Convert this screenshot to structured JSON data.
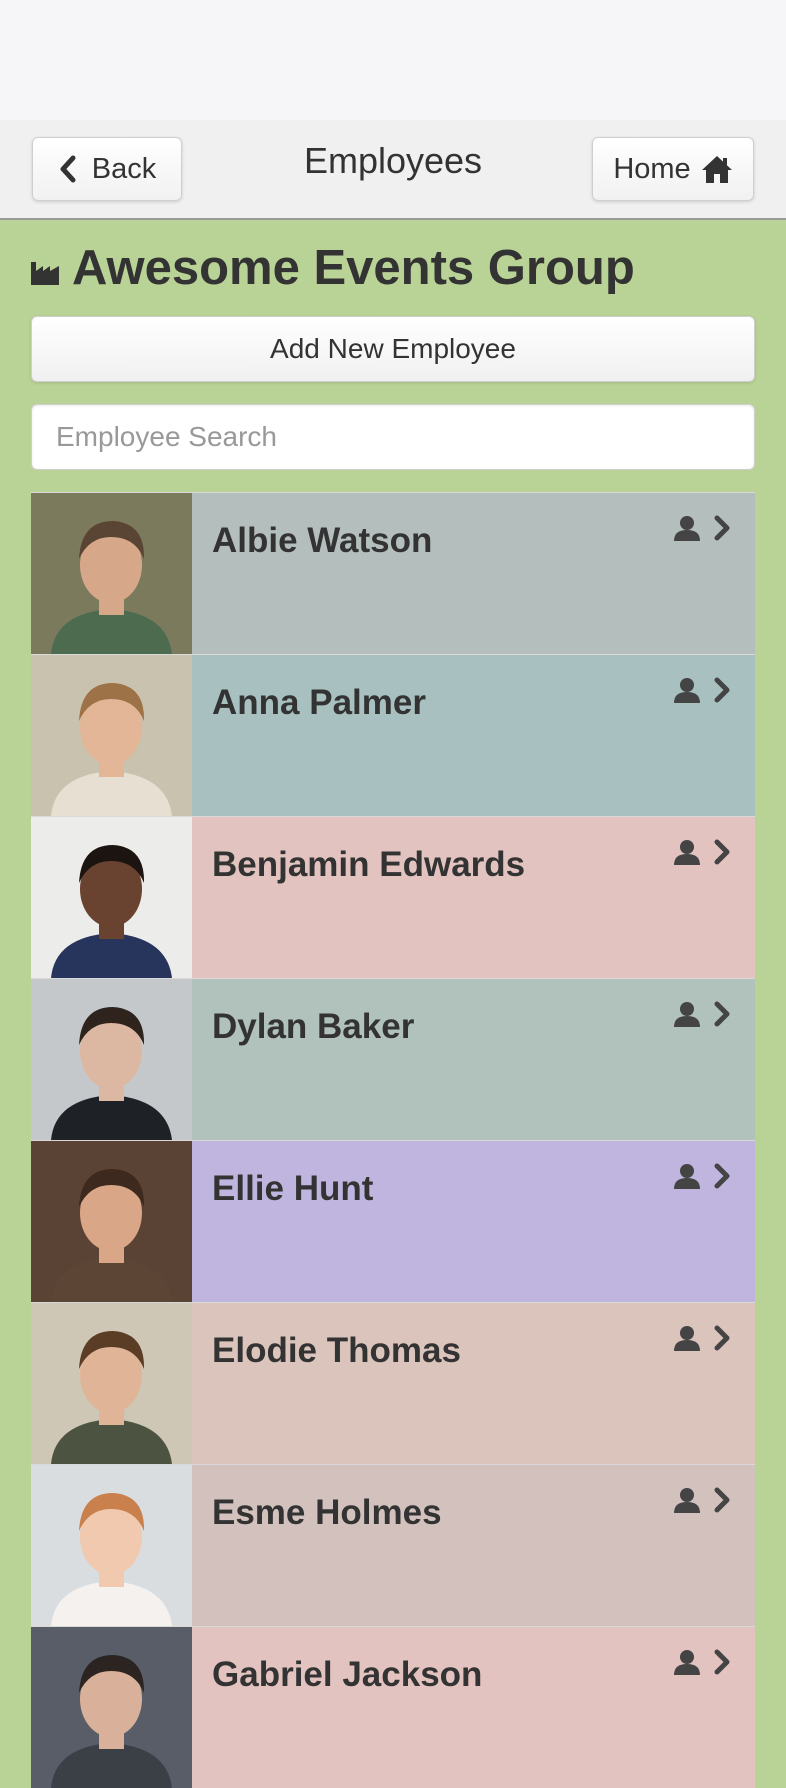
{
  "header": {
    "back_label": "Back",
    "title": "Employees",
    "home_label": "Home"
  },
  "company": {
    "name": "Awesome Events Group",
    "icon": "industry-icon"
  },
  "actions": {
    "add_label": "Add New Employee"
  },
  "search": {
    "placeholder": "Employee Search",
    "value": ""
  },
  "employees": [
    {
      "name": "Albie Watson",
      "color": "#b4bfbd",
      "photo": {
        "bg": "#7b7a5c",
        "skin": "#d6a889",
        "hair": "#5a4434",
        "shirt": "#4c6b4f"
      }
    },
    {
      "name": "Anna Palmer",
      "color": "#a9c0c0",
      "photo": {
        "bg": "#c9c2ae",
        "skin": "#e2b696",
        "hair": "#9c7246",
        "shirt": "#e7dfd2"
      }
    },
    {
      "name": "Benjamin Edwards",
      "color": "#e2c3bf",
      "photo": {
        "bg": "#ececea",
        "skin": "#6a4230",
        "hair": "#1c1410",
        "shirt": "#27345b"
      }
    },
    {
      "name": "Dylan Baker",
      "color": "#b1c1bb",
      "photo": {
        "bg": "#c4c8cb",
        "skin": "#dcb7a2",
        "hair": "#2e241d",
        "shirt": "#1e2126"
      }
    },
    {
      "name": "Ellie Hunt",
      "color": "#c0b5df",
      "photo": {
        "bg": "#5a4234",
        "skin": "#d9a788",
        "hair": "#3d291d",
        "shirt": "#5d4535"
      }
    },
    {
      "name": "Elodie Thomas",
      "color": "#dbc4bc",
      "photo": {
        "bg": "#cfc7b5",
        "skin": "#e0b597",
        "hair": "#5b3c25",
        "shirt": "#4c5441"
      }
    },
    {
      "name": "Esme Holmes",
      "color": "#d2c1bd",
      "photo": {
        "bg": "#d9dde0",
        "skin": "#f0c9ae",
        "hair": "#c9804c",
        "shirt": "#f4f1ee"
      }
    },
    {
      "name": "Gabriel Jackson",
      "color": "#e2c3bf",
      "photo": {
        "bg": "#595d68",
        "skin": "#d9b19a",
        "hair": "#2b2420",
        "shirt": "#3b3f46"
      }
    }
  ]
}
